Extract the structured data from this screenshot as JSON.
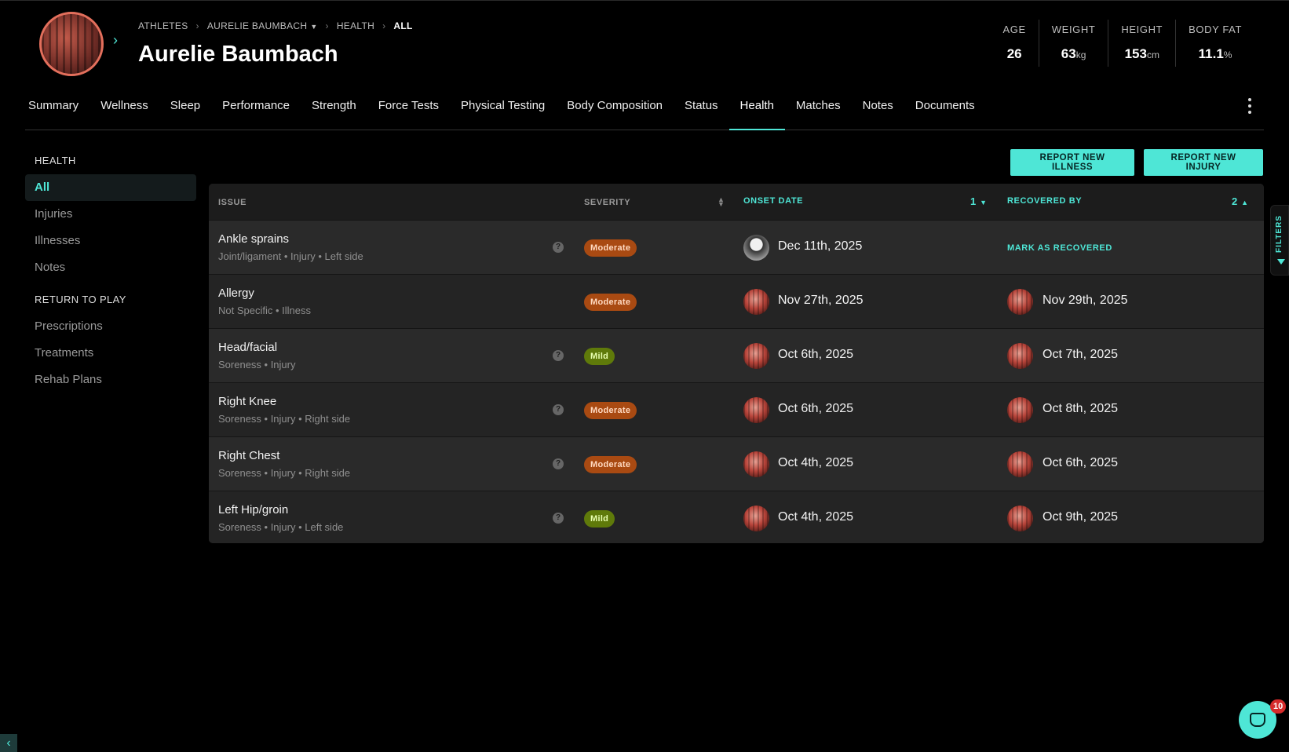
{
  "header": {
    "breadcrumb": [
      "ATHLETES",
      "AURELIE BAUMBACH",
      "HEALTH",
      "ALL"
    ],
    "athlete_name": "Aurelie Baumbach",
    "stats": [
      {
        "label": "AGE",
        "value": "26",
        "unit": ""
      },
      {
        "label": "WEIGHT",
        "value": "63",
        "unit": "kg"
      },
      {
        "label": "HEIGHT",
        "value": "153",
        "unit": "cm"
      },
      {
        "label": "BODY FAT",
        "value": "11.1",
        "unit": "%"
      }
    ]
  },
  "tabs": [
    "Summary",
    "Wellness",
    "Sleep",
    "Performance",
    "Strength",
    "Force Tests",
    "Physical Testing",
    "Body Composition",
    "Status",
    "Health",
    "Matches",
    "Notes",
    "Documents"
  ],
  "active_tab": "Health",
  "sidebar": {
    "health_heading": "HEALTH",
    "health_items": [
      "All",
      "Injuries",
      "Illnesses",
      "Notes"
    ],
    "rtp_heading": "RETURN TO PLAY",
    "rtp_items": [
      "Prescriptions",
      "Treatments",
      "Rehab Plans"
    ]
  },
  "actions": {
    "report_illness": "REPORT NEW ILLNESS",
    "report_injury": "REPORT NEW INJURY"
  },
  "table": {
    "columns": {
      "issue": "ISSUE",
      "severity": "SEVERITY",
      "onset": "ONSET DATE",
      "onset_sort_rank": "1",
      "recovered": "RECOVERED BY",
      "recovered_sort_rank": "2"
    },
    "rows": [
      {
        "title": "Ankle sprains",
        "meta": "Joint/ligament • Injury • Left side",
        "help": true,
        "severity": "Moderate",
        "onset": "Dec 11th, 2025",
        "onset_by": "staff",
        "recovered": "",
        "action": "MARK AS RECOVERED"
      },
      {
        "title": "Allergy",
        "meta": "Not Specific • Illness",
        "help": false,
        "severity": "Moderate",
        "onset": "Nov 27th, 2025",
        "onset_by": "athlete",
        "recovered": "Nov 29th, 2025",
        "action": ""
      },
      {
        "title": "Head/facial",
        "meta": "Soreness • Injury",
        "help": true,
        "severity": "Mild",
        "onset": "Oct 6th, 2025",
        "onset_by": "athlete",
        "recovered": "Oct 7th, 2025",
        "action": ""
      },
      {
        "title": "Right Knee",
        "meta": "Soreness • Injury • Right side",
        "help": true,
        "severity": "Moderate",
        "onset": "Oct 6th, 2025",
        "onset_by": "athlete",
        "recovered": "Oct 8th, 2025",
        "action": ""
      },
      {
        "title": "Right Chest",
        "meta": "Soreness • Injury • Right side",
        "help": true,
        "severity": "Moderate",
        "onset": "Oct 4th, 2025",
        "onset_by": "athlete",
        "recovered": "Oct 6th, 2025",
        "action": ""
      },
      {
        "title": "Left Hip/groin",
        "meta": "Soreness • Injury • Left side",
        "help": true,
        "severity": "Mild",
        "onset": "Oct 4th, 2025",
        "onset_by": "athlete",
        "recovered": "Oct 9th, 2025",
        "action": ""
      }
    ]
  },
  "filters_label": "FILTERS",
  "chat": {
    "unread_count": "10"
  },
  "colors": {
    "accent": "#4ee6d6",
    "moderate": "#a94a12",
    "mild": "#5f7a0a",
    "background": "#000000"
  }
}
